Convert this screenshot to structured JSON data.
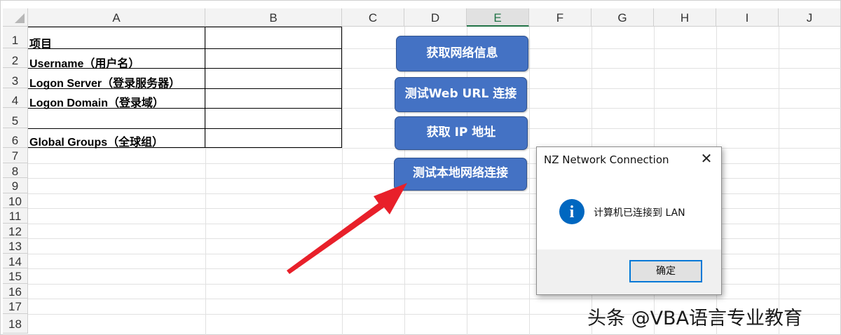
{
  "columns": [
    "A",
    "B",
    "C",
    "D",
    "E",
    "F",
    "G",
    "H",
    "I",
    "J"
  ],
  "rows": [
    "1",
    "2",
    "3",
    "4",
    "5",
    "6",
    "7",
    "8",
    "9",
    "10",
    "11",
    "12",
    "13",
    "14",
    "15",
    "16",
    "17",
    "18"
  ],
  "cells": {
    "a1": "项目",
    "a2": "Username（用户名）",
    "a3": "Logon Server（登录服务器）",
    "a4": "Logon Domain（登录域）",
    "a6": "Global Groups（全球组）"
  },
  "buttons": {
    "get_network_info": "获取网络信息",
    "test_web_url": "测试Web URL 连接",
    "get_ip": "获取 IP 地址",
    "test_local_network": "测试本地网络连接"
  },
  "dialog": {
    "title": "NZ Network Connection",
    "message": "计算机已连接到 LAN",
    "ok_label": "确定",
    "close_glyph": "✕",
    "info_glyph": "i"
  },
  "watermark": "头条 @VBA语言专业教育",
  "colors": {
    "button_fill": "#4472c4",
    "arrow": "#e8202a",
    "info_icon": "#0067c0",
    "selected_header": "#217346"
  }
}
